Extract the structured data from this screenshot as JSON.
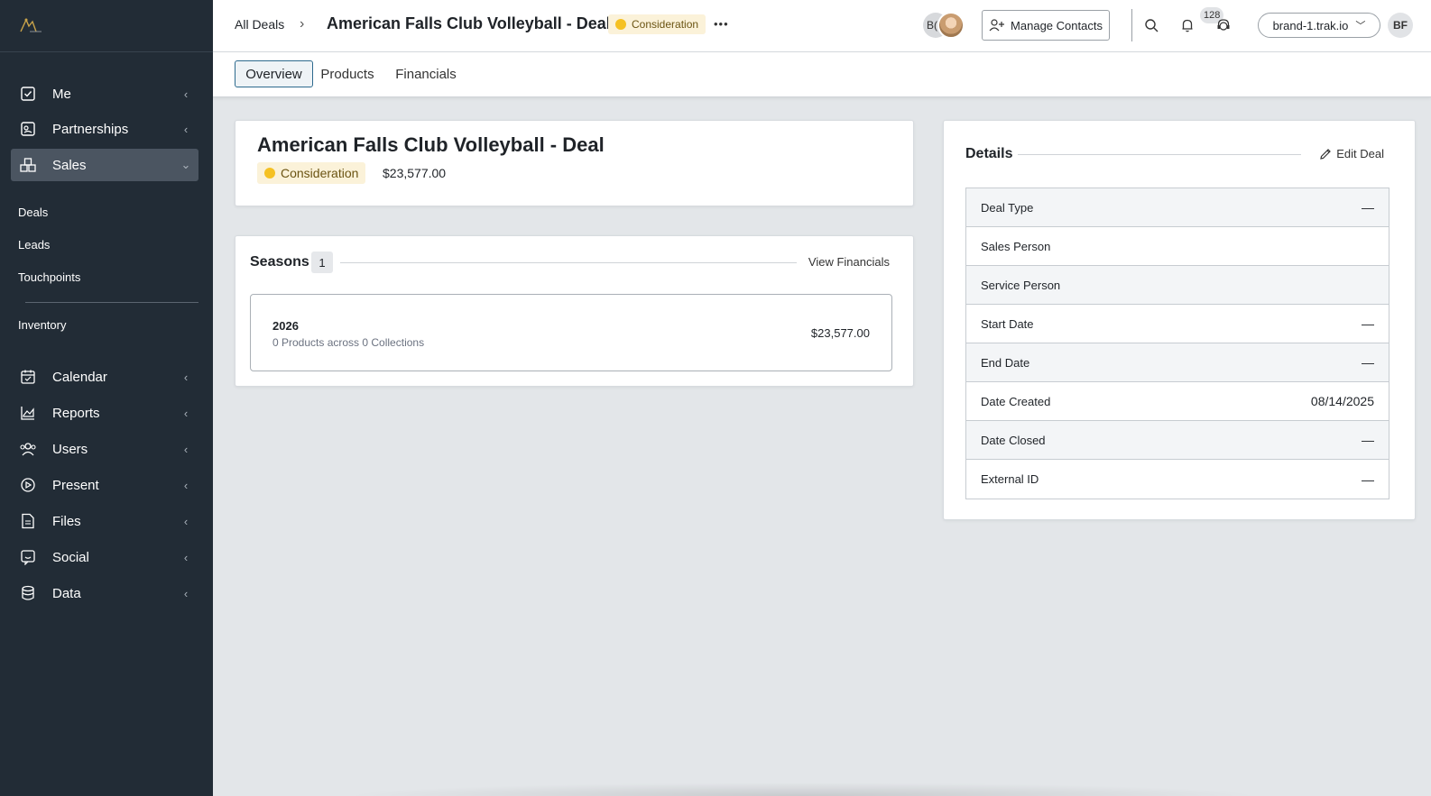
{
  "sidebar": {
    "items": [
      {
        "label": "Me",
        "icon": "checkbox-icon"
      },
      {
        "label": "Partnerships",
        "icon": "handshake-icon"
      },
      {
        "label": "Sales",
        "icon": "boxes-icon"
      },
      {
        "label": "Calendar",
        "icon": "calendar-icon"
      },
      {
        "label": "Reports",
        "icon": "chart-icon"
      },
      {
        "label": "Users",
        "icon": "users-icon"
      },
      {
        "label": "Present",
        "icon": "play-icon"
      },
      {
        "label": "Files",
        "icon": "file-icon"
      },
      {
        "label": "Social",
        "icon": "social-icon"
      },
      {
        "label": "Data",
        "icon": "database-icon"
      }
    ],
    "sales_sub": [
      "Deals",
      "Leads",
      "Touchpoints"
    ],
    "inventory": "Inventory"
  },
  "header": {
    "crumb_all": "All Deals",
    "crumb_sep": "›",
    "title": "American Falls Club Volleyball - Deal",
    "status": "Consideration",
    "more": "•••",
    "avatar_initials": "B(",
    "manage_contacts": "Manage Contacts",
    "notif_count": "128",
    "tenant": "brand-1.trak.io",
    "user_initials": "BF"
  },
  "tabs": [
    "Overview",
    "Products",
    "Financials"
  ],
  "deal_card": {
    "title": "American Falls Club Volleyball - Deal",
    "status": "Consideration",
    "amount": "$23,577.00"
  },
  "seasons": {
    "title": "Seasons",
    "count": "1",
    "view_financials": "View Financials",
    "rows": [
      {
        "year": "2026",
        "summary": "0 Products across 0 Collections",
        "amount": "$23,577.00"
      }
    ]
  },
  "details": {
    "title": "Details",
    "edit": "Edit Deal",
    "rows": [
      {
        "label": "Deal Type",
        "value": "—"
      },
      {
        "label": "Sales Person",
        "value": ""
      },
      {
        "label": "Service Person",
        "value": ""
      },
      {
        "label": "Start Date",
        "value": "—"
      },
      {
        "label": "End Date",
        "value": "—"
      },
      {
        "label": "Date Created",
        "value": "08/14/2025"
      },
      {
        "label": "Date Closed",
        "value": "—"
      },
      {
        "label": "External ID",
        "value": "—"
      }
    ]
  },
  "colors": {
    "sidebar_bg": "#222c36",
    "status_dot": "#f5c123",
    "status_bg": "#fbf2d9",
    "active_tab_border": "#2d6a8e"
  }
}
